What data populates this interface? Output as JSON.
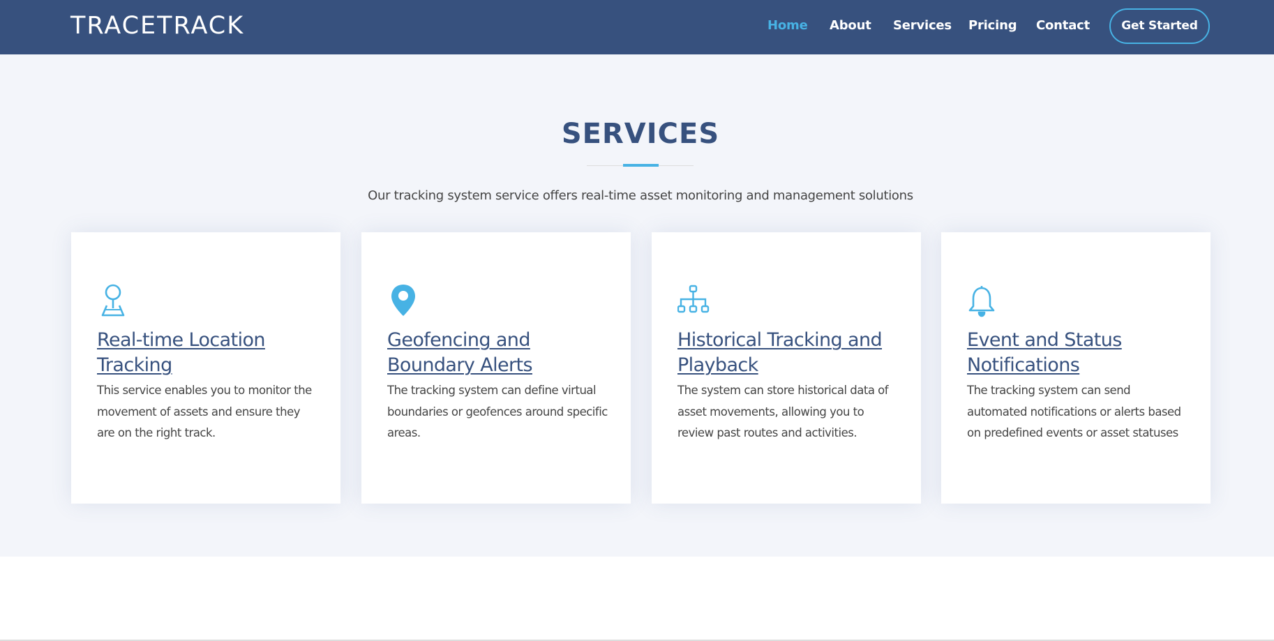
{
  "brand": {
    "name": "TRACETRACK"
  },
  "nav": {
    "items": [
      {
        "label": "Home",
        "active": true
      },
      {
        "label": "About",
        "active": false
      },
      {
        "label": "Services",
        "active": false
      },
      {
        "label": "Pricing",
        "active": false
      },
      {
        "label": "Contact",
        "active": false
      }
    ],
    "cta_label": "Get Started"
  },
  "services": {
    "title": "SERVICES",
    "subtitle": "Our tracking system service offers real-time asset monitoring and management solutions",
    "cards": [
      {
        "icon": "map-pin-person-icon",
        "title": "Real-time Location Tracking",
        "text": "This service enables you to monitor the movement of assets and ensure they are on the right track."
      },
      {
        "icon": "geo-marker-icon",
        "title": "Geofencing and Boundary Alerts",
        "text": "The tracking system can define virtual boundaries or geofences around specific areas."
      },
      {
        "icon": "diagram-hierarchy-icon",
        "title": "Historical Tracking and Playback",
        "text": "The system can store historical data of asset movements, allowing you to review past routes and activities."
      },
      {
        "icon": "bell-icon",
        "title": "Event and Status Notifications",
        "text": "The tracking system can send automated notifications or alerts based on predefined events or asset statuses"
      }
    ]
  },
  "colors": {
    "header_bg": "#37517e",
    "accent": "#47b2e4",
    "section_bg": "#f3f5fa",
    "title": "#37517e"
  }
}
